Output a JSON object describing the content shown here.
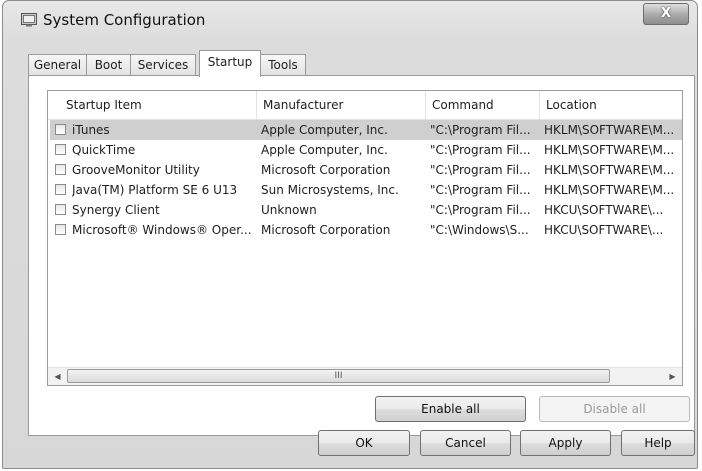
{
  "window": {
    "title": "System Configuration",
    "close_glyph": "X",
    "icon": "msconfig-icon"
  },
  "tabs": [
    "General",
    "Boot",
    "Services",
    "Startup",
    "Tools"
  ],
  "active_tab": "Startup",
  "columns": [
    "Startup Item",
    "Manufacturer",
    "Command",
    "Location"
  ],
  "rows": [
    {
      "item": "iTunes",
      "manufacturer": "Apple Computer, Inc.",
      "command": "\"C:\\Program Fil...",
      "location": "HKLM\\SOFTWARE\\M...",
      "checked": false,
      "selected": true
    },
    {
      "item": "QuickTime",
      "manufacturer": "Apple Computer, Inc.",
      "command": "\"C:\\Program Fil...",
      "location": "HKLM\\SOFTWARE\\M...",
      "checked": false,
      "selected": false
    },
    {
      "item": "GrooveMonitor Utility",
      "manufacturer": "Microsoft Corporation",
      "command": "\"C:\\Program Fil...",
      "location": "HKLM\\SOFTWARE\\M...",
      "checked": false,
      "selected": false
    },
    {
      "item": "Java(TM) Platform SE 6 U13",
      "manufacturer": "Sun Microsystems, Inc.",
      "command": "\"C:\\Program Fil...",
      "location": "HKLM\\SOFTWARE\\M...",
      "checked": false,
      "selected": false
    },
    {
      "item": "Synergy Client",
      "manufacturer": "Unknown",
      "command": "\"C:\\Program Fil...",
      "location": "HKCU\\SOFTWARE\\...",
      "checked": false,
      "selected": false
    },
    {
      "item": "Microsoft® Windows® Oper...",
      "manufacturer": "Microsoft Corporation",
      "command": "\"C:\\Windows\\S...",
      "location": "HKCU\\SOFTWARE\\...",
      "checked": false,
      "selected": false
    }
  ],
  "scroll": {
    "left_arrow": "◀",
    "right_arrow": "▶",
    "thumb_grip": "III"
  },
  "panel_buttons": {
    "enable_all": "Enable all",
    "disable_all": "Disable all"
  },
  "dialog_buttons": {
    "ok": "OK",
    "cancel": "Cancel",
    "apply": "Apply",
    "help": "Help"
  },
  "colors": {
    "selection": "#cfcfcf",
    "window_bg": "#dcdcdc",
    "disabled_text": "#9a9a9a"
  }
}
